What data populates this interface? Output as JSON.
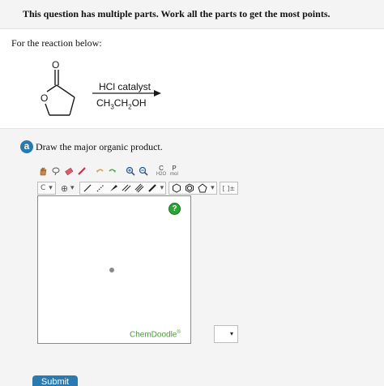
{
  "header": {
    "notice": "This question has multiple parts. Work all the parts to get the most points."
  },
  "question": {
    "prompt": "For the reaction below:",
    "reagent_top": "HCl catalyst",
    "reagent_bottom": "CH3CH2OH",
    "atom_o_carbonyl": "O",
    "atom_o_ring": "O"
  },
  "part": {
    "badge": "a",
    "instruction": "Draw the major organic product."
  },
  "editor": {
    "toolbar": {
      "carbon_label": "C",
      "charge_plus": "⊕",
      "bracket_label": "[ ]±",
      "c_box_label": "C",
      "c_box_sub": "H2O",
      "p_box_label": "P",
      "p_box_sub": "mol",
      "dropdown_caret": "▾"
    },
    "help": "?",
    "watermark": "ChemDoodle",
    "watermark_mark": "®"
  },
  "select": {
    "caret": "▾"
  },
  "submit_label": "Submit"
}
